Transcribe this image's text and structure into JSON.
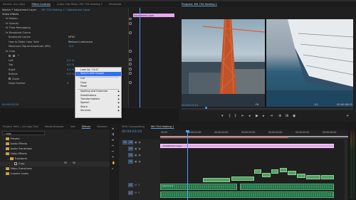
{
  "left_top_tabs": [
    "Source: (no clips)",
    "Effect Controls",
    "Audio Clip Mixer: MH 704 Heating 1",
    "Metadata"
  ],
  "effect_controls": {
    "source": "Master * Adjustment Layer",
    "sequence": "MH 704 Heating 1 * Adjustment Layer",
    "header": "Video Effects",
    "clip_label": "Adjustment Layer",
    "rows": [
      {
        "label": "fx Motion",
        "indent": 1
      },
      {
        "label": "fx Opacity",
        "indent": 1
      },
      {
        "label": "fx Time Remapping",
        "indent": 1
      },
      {
        "label": "fx Broadcast Colors",
        "indent": 1
      },
      {
        "label": "Broadcast Locale",
        "indent": 2
      },
      {
        "label": "How to Make Color Safe",
        "indent": 2
      },
      {
        "label": "Maximum Signal Amplitude (IRE)",
        "indent": 2
      },
      {
        "label": "fx Crop",
        "indent": 1
      },
      {
        "label": "Left",
        "indent": 2
      },
      {
        "label": "Top",
        "indent": 2
      },
      {
        "label": "Right",
        "indent": 2
      },
      {
        "label": "Bottom",
        "indent": 2
      },
      {
        "label": "Zoom",
        "indent": 2
      },
      {
        "label": "Edge Feather",
        "indent": 2
      }
    ],
    "values": {
      "locale": "NTSC",
      "color_safe": "Reduce Luminance",
      "ire": "110",
      "left": "0.0 %",
      "top": "0.0 %",
      "right": "0.0 %",
      "bottom": "0.0 %",
      "feather": "0"
    },
    "timecode": "00:00:03:24"
  },
  "context_menu": {
    "items": [
      "Look Up “10.0”",
      "Search with Google",
      "Cut",
      "Copy",
      "Paste",
      "Spelling and Grammar",
      "Substitutions",
      "Transformations",
      "Speech",
      "Share",
      "Services"
    ],
    "selected_index": 1,
    "submenu_indices": [
      5,
      6,
      7,
      8,
      9,
      10
    ]
  },
  "program": {
    "tab": "Program: MH 704 Heating 1",
    "timecode": "00:00:03:24",
    "zoom": "Fit",
    "quality": "1/2",
    "duration": "00:00:08:02"
  },
  "project": {
    "tabs": [
      "Project: MH4 ...All Loop Test",
      "Media Browser",
      "Info",
      "Effects",
      "Markers"
    ],
    "search": "crop",
    "items": [
      {
        "name": "Presets",
        "level": 0
      },
      {
        "name": "Audio Effects",
        "level": 0
      },
      {
        "name": "Audio Transitions",
        "level": 0
      },
      {
        "name": "Video Effects",
        "level": 0
      },
      {
        "name": "Transform",
        "level": 1
      },
      {
        "name": "Crop",
        "level": 2
      },
      {
        "name": "Video Transitions",
        "level": 0
      },
      {
        "name": "Lumetri Looks",
        "level": 0
      }
    ]
  },
  "timeline": {
    "tabs": [
      "MH4 Compositing",
      "MH 704 Heating 1"
    ],
    "timecode": "00:00:03:24",
    "ruler": [
      "00:00",
      "00:00:01:00",
      "00:00:02:00",
      "00:00:03:00",
      "00:00:04:00",
      "00:00:05:00",
      "00:00:06:00"
    ],
    "tracks": [
      "V4",
      "V3",
      "V2",
      "V1",
      "A1",
      "A2"
    ],
    "adjustment_clip": "Adjustment Layer",
    "audio_clip": "Adjustment..."
  },
  "colors": {
    "accent": "#2f6ff0",
    "playhead": "#4ea0ff",
    "video_clip": "#52a062",
    "audio_clip": "#1f6a3f",
    "adjustment": "#e9a9f0"
  }
}
